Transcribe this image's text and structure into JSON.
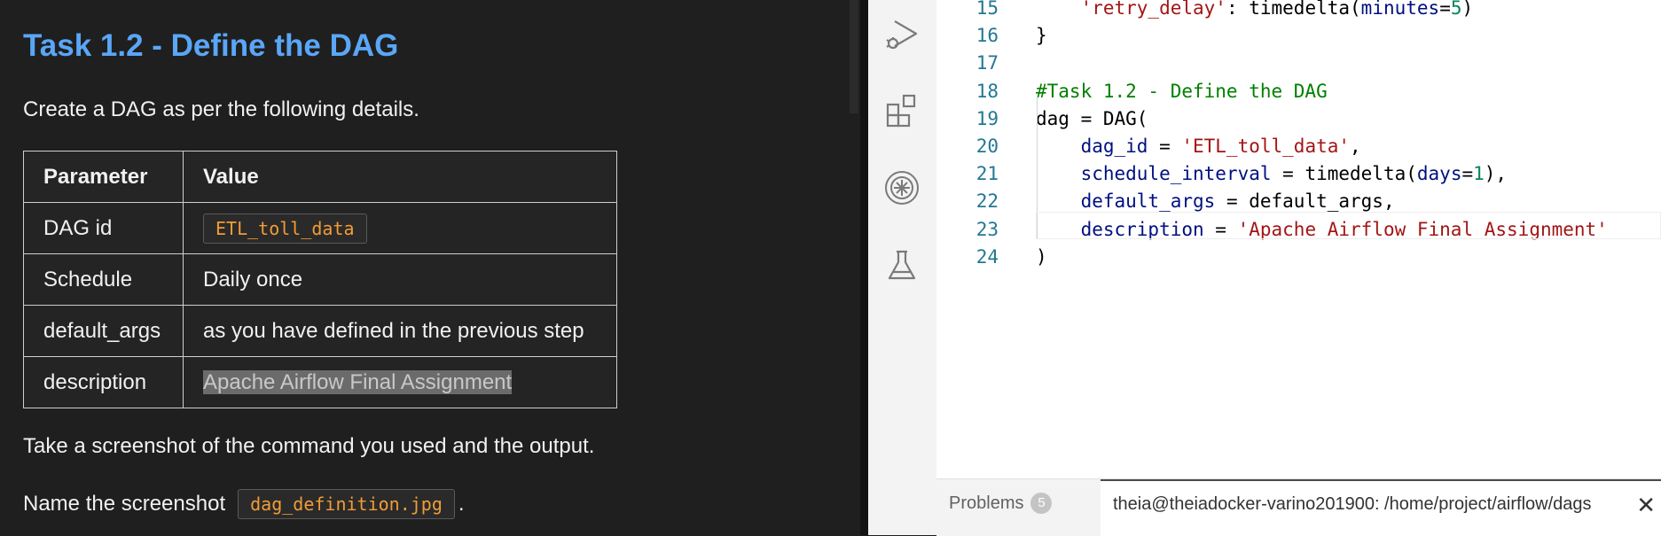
{
  "instructions": {
    "title": "Task 1.2 - Define the DAG",
    "intro": "Create a DAG as per the following details.",
    "table": {
      "headers": [
        "Parameter",
        "Value"
      ],
      "rows": [
        {
          "param": "DAG id",
          "value": "ETL_toll_data"
        },
        {
          "param": "Schedule",
          "value": "Daily once"
        },
        {
          "param": "default_args",
          "value": "as you have defined in the previous step"
        },
        {
          "param": "description",
          "value": "Apache Airflow Final Assignment"
        }
      ]
    },
    "screenshot_text": "Take a screenshot of the command you used and the output.",
    "name_prefix": "Name the screenshot",
    "filename": "dag_definition.jpg",
    "name_suffix": "."
  },
  "activity_bar": {
    "icons": [
      "run-debug-icon",
      "extensions-icon",
      "skills-network-icon",
      "test-flask-icon"
    ]
  },
  "editor": {
    "lines": [
      {
        "n": "15",
        "tokens": [
          [
            "s",
            "'retry_delay'"
          ],
          [
            "p",
            ": timedelta("
          ],
          [
            "v",
            "minutes"
          ],
          [
            "p",
            "="
          ],
          [
            "num",
            "5"
          ],
          [
            "p",
            ")"
          ]
        ],
        "indent": 1
      },
      {
        "n": "16",
        "tokens": [
          [
            "p",
            "}"
          ]
        ],
        "indent": 0
      },
      {
        "n": "17",
        "tokens": [],
        "indent": 0
      },
      {
        "n": "18",
        "tokens": [
          [
            "c",
            "#Task 1.2 - Define the DAG"
          ]
        ],
        "indent": 0
      },
      {
        "n": "19",
        "tokens": [
          [
            "p",
            "dag = DAG("
          ]
        ],
        "indent": 0
      },
      {
        "n": "20",
        "tokens": [
          [
            "v",
            "dag_id"
          ],
          [
            "p",
            " = "
          ],
          [
            "s",
            "'ETL_toll_data'"
          ],
          [
            "p",
            ","
          ]
        ],
        "indent": 1
      },
      {
        "n": "21",
        "tokens": [
          [
            "v",
            "schedule_interval"
          ],
          [
            "p",
            " = timedelta("
          ],
          [
            "v",
            "days"
          ],
          [
            "p",
            "="
          ],
          [
            "num",
            "1"
          ],
          [
            "p",
            "),"
          ]
        ],
        "indent": 1
      },
      {
        "n": "22",
        "tokens": [
          [
            "v",
            "default_args"
          ],
          [
            "p",
            " = default_args,"
          ]
        ],
        "indent": 1
      },
      {
        "n": "23",
        "tokens": [
          [
            "v",
            "description"
          ],
          [
            "p",
            " = "
          ],
          [
            "s",
            "'Apache Airflow Final Assignment'"
          ]
        ],
        "indent": 1
      },
      {
        "n": "24",
        "tokens": [
          [
            "p",
            ")"
          ]
        ],
        "indent": 0
      }
    ]
  },
  "bottom_panel": {
    "problems_label": "Problems",
    "problems_count": "5",
    "terminal_title": "theia@theiadocker-varino201900: /home/project/airflow/dags",
    "close_glyph": "✕"
  }
}
